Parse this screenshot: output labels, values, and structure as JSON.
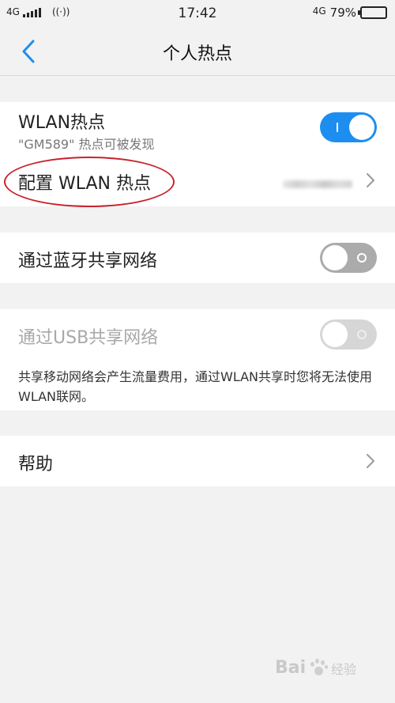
{
  "status_bar": {
    "left_network": "4G",
    "time": "17:42",
    "right_network": "4G",
    "battery_percent": "79%",
    "battery_level": 0.79
  },
  "nav": {
    "title": "个人热点"
  },
  "wlan_hotspot": {
    "title": "WLAN热点",
    "subtitle": "\"GM589\" 热点可被发现",
    "toggle_on": true
  },
  "configure_hotspot": {
    "title": "配置 WLAN 热点"
  },
  "bluetooth_tethering": {
    "title": "通过蓝牙共享网络",
    "toggle_on": false
  },
  "usb_tethering": {
    "title": "通过USB共享网络",
    "toggle_on": false,
    "disabled": true
  },
  "note": "共享移动网络会产生流量费用，通过WLAN共享时您将无法使用WLAN联网。",
  "help": {
    "title": "帮助"
  },
  "watermark": {
    "brand": "Bai",
    "suffix": "经验"
  },
  "colors": {
    "accent": "#1d8ef0",
    "annotation_red": "#c8232c"
  }
}
